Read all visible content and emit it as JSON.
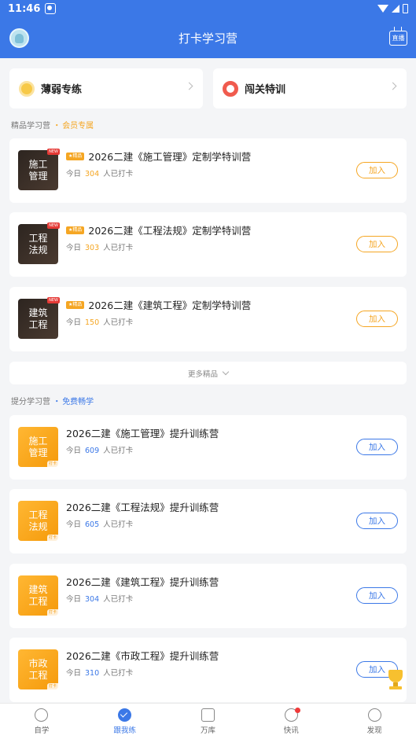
{
  "status": {
    "time": "11:46"
  },
  "header": {
    "title": "打卡学习营",
    "live_label": "直播"
  },
  "quick": [
    {
      "label": "薄弱专练"
    },
    {
      "label": "闯关特训"
    }
  ],
  "premium_section": {
    "title": "精品学习营",
    "sep": "・",
    "tag": "会员专属"
  },
  "premium": [
    {
      "thumb": "施工管理",
      "new": "NEW",
      "badge": "★精品",
      "title": "2026二建《施工管理》定制学特训营",
      "prefix": "今日",
      "count": "304",
      "suffix": "人已打卡",
      "join": "加入"
    },
    {
      "thumb": "工程法规",
      "new": "NEW",
      "badge": "★精品",
      "title": "2026二建《工程法规》定制学特训营",
      "prefix": "今日",
      "count": "303",
      "suffix": "人已打卡",
      "join": "加入"
    },
    {
      "thumb": "建筑工程",
      "new": "NEW",
      "badge": "★精品",
      "title": "2026二建《建筑工程》定制学特训营",
      "prefix": "今日",
      "count": "150",
      "suffix": "人已打卡",
      "join": "加入"
    }
  ],
  "more": "更多精品",
  "free_section": {
    "title": "提分学习营",
    "sep": "・",
    "tag": "免费畅学"
  },
  "free": [
    {
      "thumb": "施工管理",
      "daka": "打卡",
      "title": "2026二建《施工管理》提升训练营",
      "prefix": "今日",
      "count": "609",
      "suffix": "人已打卡",
      "join": "加入"
    },
    {
      "thumb": "工程法规",
      "daka": "打卡",
      "title": "2026二建《工程法规》提升训练营",
      "prefix": "今日",
      "count": "605",
      "suffix": "人已打卡",
      "join": "加入"
    },
    {
      "thumb": "建筑工程",
      "daka": "打卡",
      "title": "2026二建《建筑工程》提升训练营",
      "prefix": "今日",
      "count": "304",
      "suffix": "人已打卡",
      "join": "加入"
    },
    {
      "thumb": "市政工程",
      "daka": "打卡",
      "title": "2026二建《市政工程》提升训练营",
      "prefix": "今日",
      "count": "310",
      "suffix": "人已打卡",
      "join": "加入"
    }
  ],
  "tabs": [
    {
      "label": "自学"
    },
    {
      "label": "跟我练"
    },
    {
      "label": "万库"
    },
    {
      "label": "快讯"
    },
    {
      "label": "发现"
    }
  ],
  "colors": {
    "primary": "#3b78e7",
    "accent": "#f5a623",
    "alert": "#f03a3a"
  }
}
